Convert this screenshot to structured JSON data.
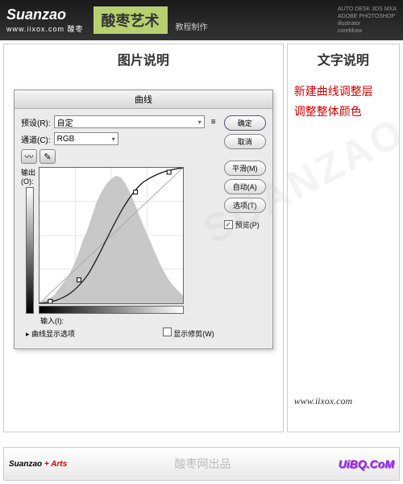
{
  "banner": {
    "brand": "Suanzao",
    "url": "www.iixox.com",
    "cn_side": "酸枣",
    "title": "酸枣艺术",
    "subtitle": "教程制作",
    "apps": [
      "AUTO DESK 3DS MXA",
      "ADOBE PHOTOSHOP",
      "illustrator",
      "coreldraw"
    ]
  },
  "left": {
    "title": "图片说明",
    "dialog": {
      "title": "曲线",
      "preset_label": "预设(R):",
      "preset_value": "自定",
      "channel_label": "通道(C):",
      "channel_value": "RGB",
      "output_label": "输出(O):",
      "input_label": "输入(I):",
      "show_clipping": "显示修剪(W)",
      "display_options": "曲线显示选项",
      "preview_label": "预览(P)",
      "buttons": {
        "ok": "确定",
        "cancel": "取消",
        "smooth": "平滑(M)",
        "auto": "自动(A)",
        "options": "选项(T)"
      }
    }
  },
  "right": {
    "title": "文字说明",
    "line1": "新建曲线调整层",
    "line2": "调整整体颜色",
    "watermark": "SUANZAO",
    "url": "www.iixox.com"
  },
  "footer": {
    "brand": "Suanzao",
    "plus": "+",
    "arts": "Arts",
    "mid": "酸枣网出品",
    "url": "UiBQ.CoM"
  },
  "chart_data": {
    "type": "line",
    "title": "曲线 (Curves)",
    "xlabel": "输入",
    "ylabel": "输出",
    "xlim": [
      0,
      255
    ],
    "ylim": [
      0,
      255
    ],
    "series": [
      {
        "name": "RGB",
        "values_x": [
          0,
          20,
          70,
          170,
          230,
          255
        ],
        "values_y": [
          0,
          4,
          45,
          208,
          248,
          255
        ]
      }
    ],
    "histogram": [
      2,
      4,
      6,
      10,
      18,
      26,
      34,
      46,
      60,
      78,
      92,
      110,
      128,
      140,
      150,
      156,
      160,
      158,
      150,
      138,
      124,
      108,
      94,
      80,
      66,
      52,
      40,
      30,
      22,
      16,
      10,
      6,
      3
    ]
  }
}
